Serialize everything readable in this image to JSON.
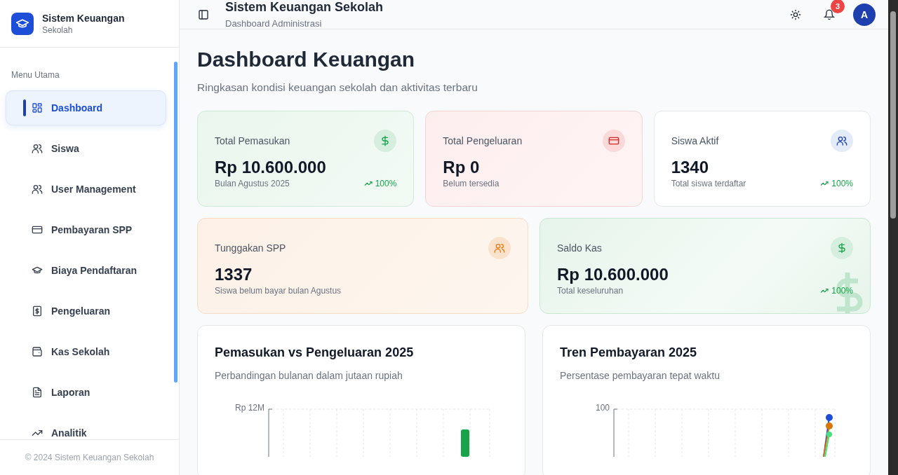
{
  "sidebar": {
    "app_title": "Sistem Keuangan",
    "app_subtitle": "Sekolah",
    "section_label": "Menu Utama",
    "items": [
      {
        "label": "Dashboard",
        "selected": true
      },
      {
        "label": "Siswa",
        "selected": false
      },
      {
        "label": "User Management",
        "selected": false
      },
      {
        "label": "Pembayaran SPP",
        "selected": false
      },
      {
        "label": "Biaya Pendaftaran",
        "selected": false
      },
      {
        "label": "Pengeluaran",
        "selected": false
      },
      {
        "label": "Kas Sekolah",
        "selected": false
      },
      {
        "label": "Laporan",
        "selected": false
      },
      {
        "label": "Analitik",
        "selected": false
      }
    ],
    "footer": "© 2024 Sistem Keuangan Sekolah"
  },
  "header": {
    "title": "Sistem Keuangan Sekolah",
    "subtitle": "Dashboard Administrasi",
    "notification_count": "3",
    "avatar": "A"
  },
  "page": {
    "title": "Dashboard Keuangan",
    "subtitle": "Ringkasan kondisi keuangan sekolah dan aktivitas terbaru"
  },
  "stat_rows": [
    [
      {
        "kind": "income",
        "label": "Total Pemasukan",
        "value": "Rp 10.600.000",
        "note": "Bulan Agustus 2025",
        "trend": "100%"
      },
      {
        "kind": "expense",
        "label": "Total Pengeluaran",
        "value": "Rp 0",
        "note": "Belum tersedia"
      },
      {
        "kind": "students",
        "label": "Siswa Aktif",
        "value": "1340",
        "note": "Total siswa terdaftar",
        "trend": "100%"
      }
    ],
    [
      {
        "kind": "arrears",
        "label": "Tunggakan SPP",
        "value": "1337",
        "note": "Siswa belum bayar bulan Agustus"
      },
      {
        "kind": "balance",
        "label": "Saldo Kas",
        "value": "Rp 10.600.000",
        "note": "Total keseluruhan",
        "trend": "100%"
      }
    ]
  ],
  "charts": [
    {
      "kind": "bar",
      "title": "Pemasukan vs Pengeluaran 2025",
      "subtitle": "Perbandingan bulanan dalam jutaan rupiah",
      "y_tick_label": "Rp 12M"
    },
    {
      "kind": "line",
      "title": "Tren Pembayaran 2025",
      "subtitle": "Persentase pembayaran tepat waktu",
      "y_tick_label": "100"
    }
  ]
}
